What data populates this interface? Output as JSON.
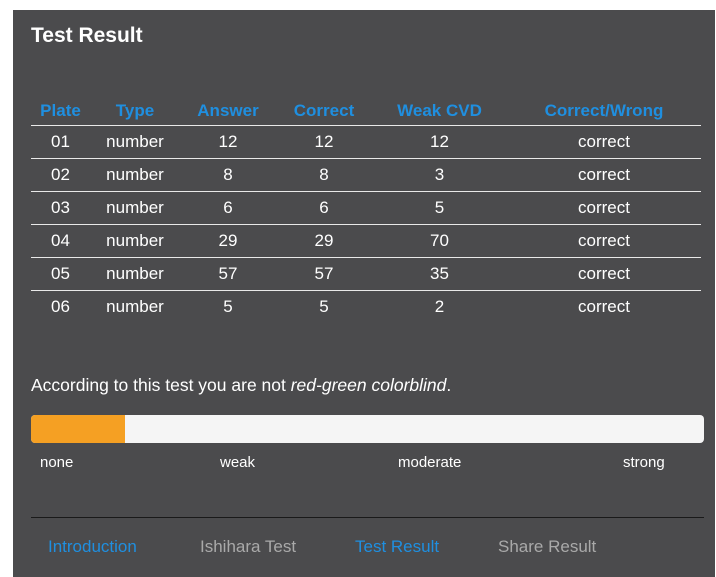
{
  "title": "Test Result",
  "table": {
    "headers": [
      "Plate",
      "Type",
      "Answer",
      "Correct",
      "Weak CVD",
      "Correct/Wrong"
    ],
    "rows": [
      [
        "01",
        "number",
        "12",
        "12",
        "12",
        "correct"
      ],
      [
        "02",
        "number",
        "8",
        "8",
        "3",
        "correct"
      ],
      [
        "03",
        "number",
        "6",
        "6",
        "5",
        "correct"
      ],
      [
        "04",
        "number",
        "29",
        "29",
        "70",
        "correct"
      ],
      [
        "05",
        "number",
        "57",
        "57",
        "35",
        "correct"
      ],
      [
        "06",
        "number",
        "5",
        "5",
        "2",
        "correct"
      ]
    ]
  },
  "verdict": {
    "prefix": "According to this test you are not ",
    "emphasis": "red-green colorblind",
    "suffix": "."
  },
  "severity": {
    "level_fraction": 0.14,
    "labels": [
      "none",
      "weak",
      "moderate",
      "strong"
    ]
  },
  "tabs": [
    {
      "label": "Introduction",
      "active": true
    },
    {
      "label": "Ishihara Test",
      "active": false
    },
    {
      "label": "Test Result",
      "active": true
    },
    {
      "label": "Share Result",
      "active": false
    }
  ],
  "colors": {
    "panel_bg": "#4b4b4d",
    "accent_blue": "#1f8fe0",
    "bar_orange": "#f5a023",
    "inactive_tab": "#a9a9a9"
  }
}
